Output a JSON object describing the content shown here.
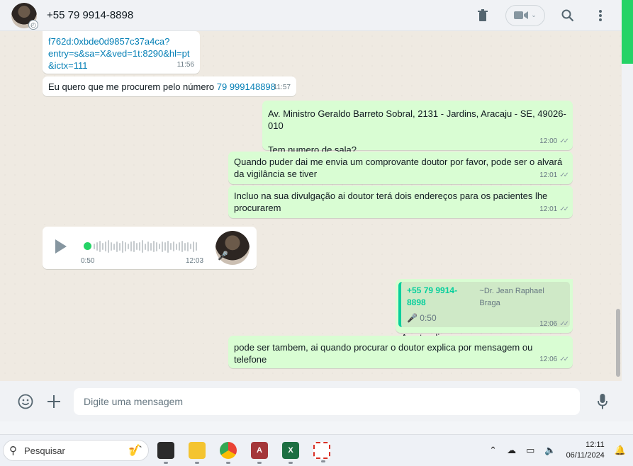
{
  "header": {
    "contact_name": "+55 79 9914-8898"
  },
  "messages": {
    "m1": {
      "link_text": "f762d:0xbde0d9857c37a4ca?\nentry=s&sa=X&ved=1t:8290&hl=pt\n&ictx=111",
      "time": "11:56"
    },
    "m2": {
      "text": "Eu quero que me procurem pelo número ",
      "link": "79 999148898",
      "time": "11:57"
    },
    "m3": {
      "line1": "Av. Ministro Geraldo Barreto Sobral, 2131 - Jardins, Aracaju - SE, 49026-010",
      "line2": "Tem numero de sala?",
      "time": "12:00"
    },
    "m4": {
      "text": "Quando puder dai me envia um comprovante doutor por favor, pode ser o alvará da vigilância se tiver",
      "time": "12:01"
    },
    "m5": {
      "text": "Incluo na sua divulgação ai doutor terá dois endereços para os pacientes lhe procurarem",
      "time": "12:01"
    },
    "voice": {
      "duration": "0:50",
      "time": "12:03"
    },
    "m6": {
      "quote_phone": "+55 79 9914-8898",
      "quote_name": "~Dr. Jean Raphael Braga",
      "quote_audio": "0:50",
      "text": "A entendi",
      "time": "12:06"
    },
    "m7": {
      "text": "pode ser tambem, ai quando procurar o doutor explica por mensagem ou telefone",
      "time": "12:06"
    }
  },
  "composer": {
    "placeholder": "Digite uma mensagem"
  },
  "taskbar": {
    "search_label": "Pesquisar",
    "time": "12:11",
    "date": "06/11/2024"
  },
  "colors": {
    "outgoing_bubble": "#d9fdd3",
    "incoming_bubble": "#ffffff",
    "accent": "#25d366"
  }
}
